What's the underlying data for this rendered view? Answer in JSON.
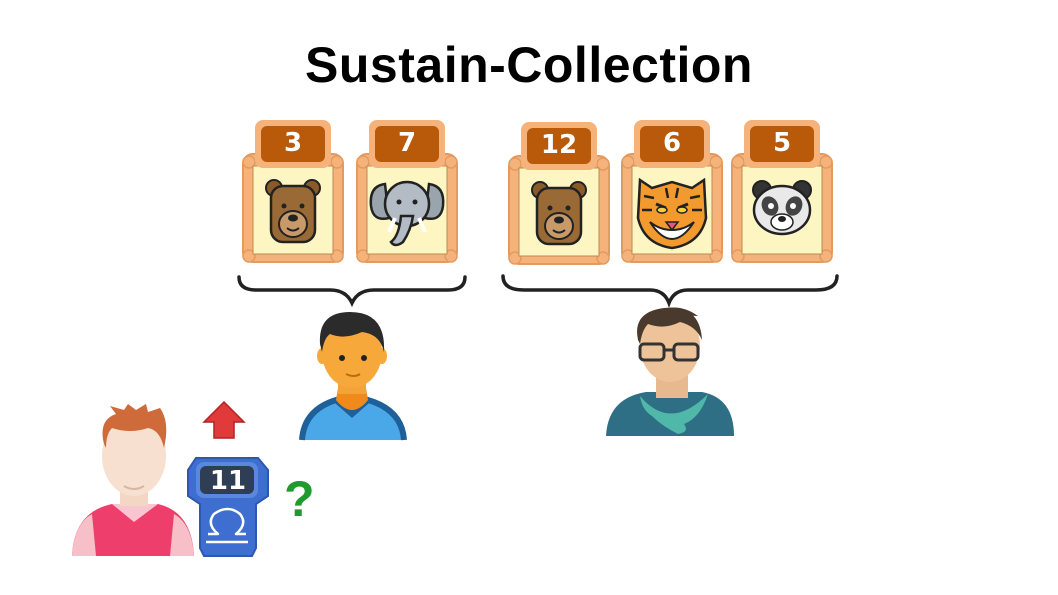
{
  "title": "Sustain-Collection",
  "left_group": {
    "cards": [
      {
        "number": "3",
        "animal": "bear-icon"
      },
      {
        "number": "7",
        "animal": "elephant-icon"
      }
    ],
    "player_icon": "player-boy-icon"
  },
  "right_group": {
    "cards": [
      {
        "number": "12",
        "animal": "bear-icon"
      },
      {
        "number": "6",
        "animal": "tiger-icon"
      },
      {
        "number": "5",
        "animal": "panda-icon"
      }
    ],
    "player_icon": "player-man-glasses-icon"
  },
  "current_player": {
    "icon": "player-pink-shirt-icon",
    "badge_number": "11",
    "badge_icon": "libra-icon",
    "arrow_icon": "up-arrow-icon",
    "question": "?"
  },
  "colors": {
    "card_frame": "#f5b27a",
    "card_inner": "#fdf6c3",
    "number_tab": "#b85a0a",
    "badge_blue": "#3e6fd0",
    "badge_dark": "#2e3f55",
    "arrow_red": "#e03a3a",
    "question_green": "#1f9a2f"
  }
}
